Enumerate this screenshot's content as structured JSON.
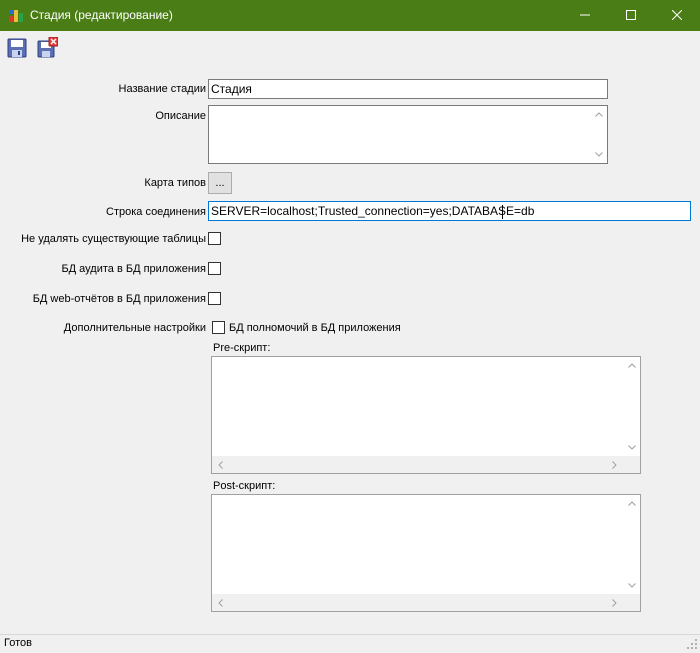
{
  "window": {
    "title": "Стадия (редактирование)"
  },
  "toolbar": {
    "save_icon": "save-icon",
    "save_close_icon": "save-close-icon"
  },
  "form": {
    "stage_name_label": "Название стадии",
    "stage_name_value": "Стадия",
    "description_label": "Описание",
    "description_value": "",
    "type_map_label": "Карта типов",
    "type_map_button": "...",
    "connection_label": "Строка соединения",
    "connection_value": "SERVER=localhost;Trusted_connection=yes;DATABASE=db",
    "keep_tables_label": "Не удалять существующие таблицы",
    "audit_db_label": "БД аудита в БД приложения",
    "web_reports_label": "БД web-отчётов в БД приложения",
    "extra_settings_label": "Дополнительные настройки",
    "permissions_db_label": "БД полномочий в БД приложения",
    "pre_script_label": "Pre-скрипт:",
    "pre_script_value": "",
    "post_script_label": "Post-скрипт:",
    "post_script_value": ""
  },
  "statusbar": {
    "text": "Готов"
  },
  "colors": {
    "titlebar": "#4a7d16",
    "background": "#f0f0f0",
    "focus_border": "#0078d7"
  }
}
